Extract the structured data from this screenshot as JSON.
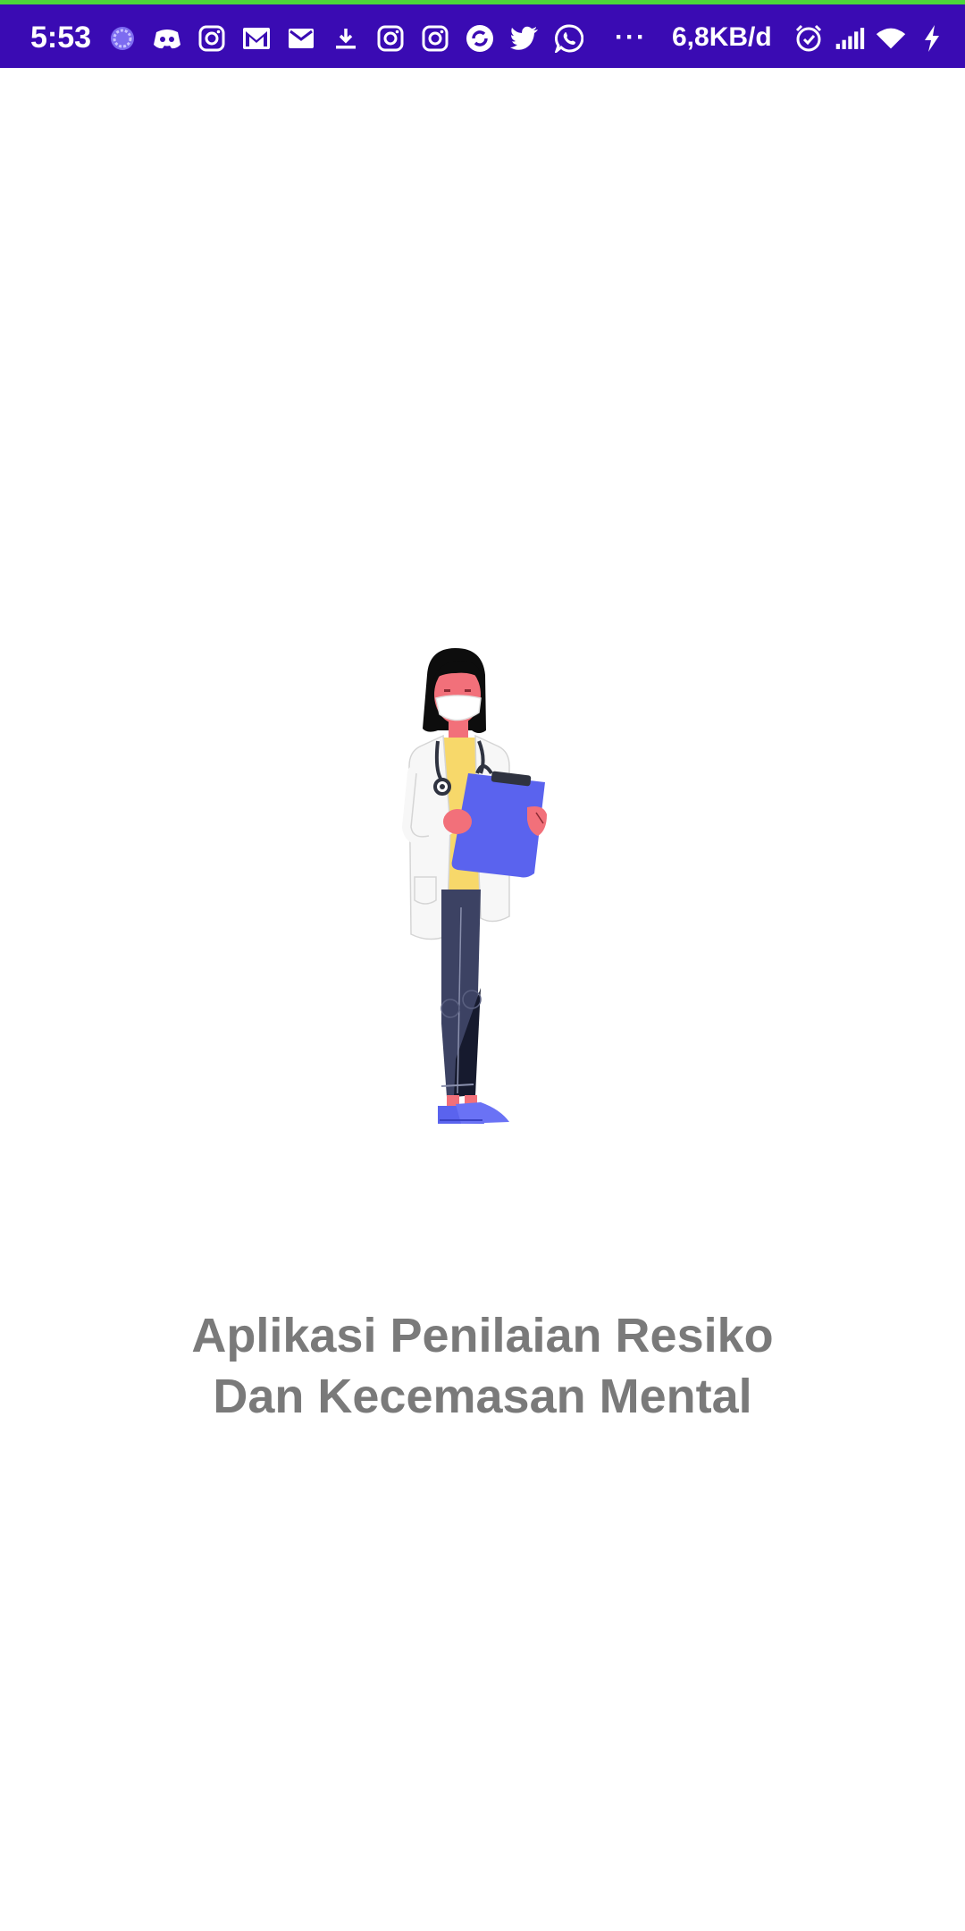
{
  "status_bar": {
    "time": "5:53",
    "more_indicator": "···",
    "network_speed": "6,8KB/d",
    "background_color": "#3a0bb3",
    "accent_line_color": "#4cd63a",
    "notification_icons": [
      "pinwheel-icon",
      "discord-icon",
      "instagram-icon",
      "gmail-icon",
      "gmail-icon",
      "download-icon",
      "instagram-icon",
      "instagram-icon",
      "sync-app-icon",
      "twitter-icon",
      "whatsapp-icon"
    ],
    "system_icons": [
      "alarm-icon",
      "signal-icon",
      "wifi-icon",
      "charging-icon"
    ]
  },
  "splash": {
    "illustration": "doctor-with-clipboard-illustration",
    "title_line1": "Aplikasi Penilaian Resiko",
    "title_line2": "Dan Kecemasan Mental",
    "title_color": "#7a7a7a"
  }
}
